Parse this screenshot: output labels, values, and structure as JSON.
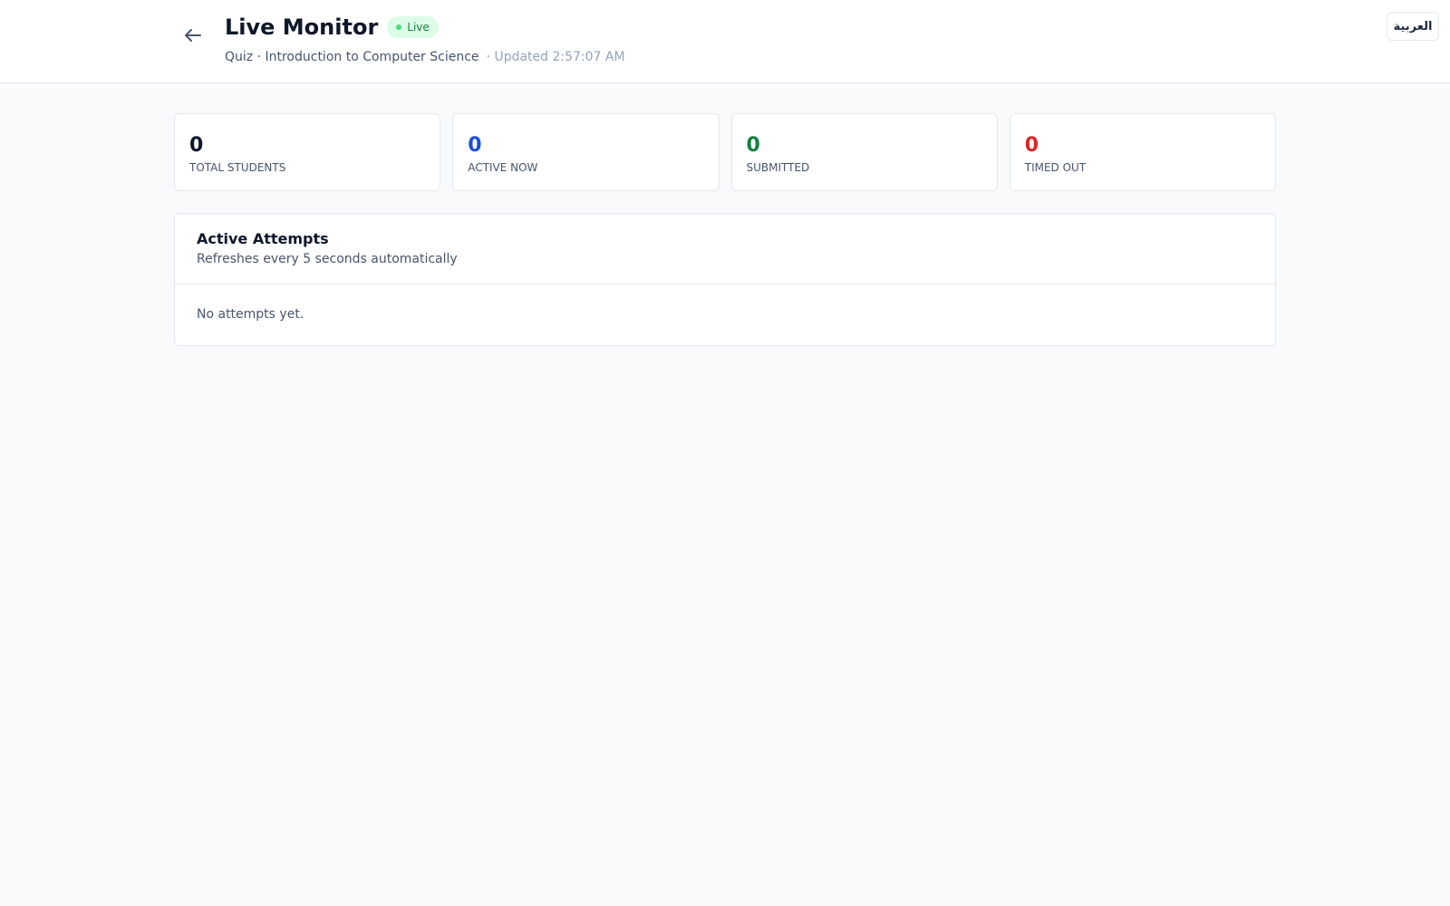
{
  "header": {
    "title": "Live Monitor",
    "live_badge": "Live",
    "subtitle": "Quiz · Introduction to Computer Science",
    "updated": "· Updated 2:57:07 AM",
    "back_icon": "arrow-left-icon",
    "language_button": "العربية"
  },
  "stats": [
    {
      "value": "0",
      "label": "TOTAL STUDENTS",
      "color": "#0f172a"
    },
    {
      "value": "0",
      "label": "ACTIVE NOW",
      "color": "#1d4ed8"
    },
    {
      "value": "0",
      "label": "SUBMITTED",
      "color": "#15803d"
    },
    {
      "value": "0",
      "label": "TIMED OUT",
      "color": "#dc2626"
    }
  ],
  "attempts": {
    "title": "Active Attempts",
    "subtitle": "Refreshes every 5 seconds automatically",
    "empty_message": "No attempts yet."
  },
  "colors": {
    "live_badge_bg": "#dcfce7",
    "live_badge_text": "#15803d",
    "page_bg": "#f8fafc"
  }
}
